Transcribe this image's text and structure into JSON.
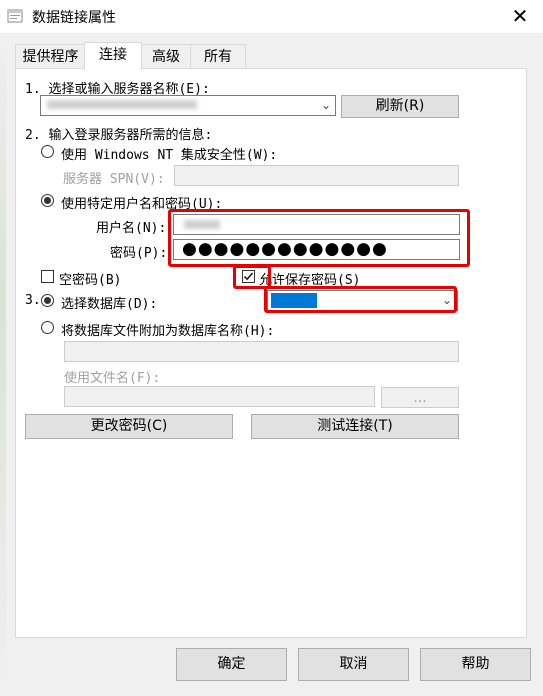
{
  "window": {
    "title": "数据链接属性",
    "icon": "data-link-icon",
    "close": "✕"
  },
  "tabs": [
    {
      "label": "提供程序"
    },
    {
      "label": "连接"
    },
    {
      "label": "高级"
    },
    {
      "label": "所有"
    }
  ],
  "step1": {
    "label": "1. 选择或输入服务器名称(E):",
    "server_value": "",
    "refresh_button": "刷新(R)"
  },
  "step2": {
    "label": "2. 输入登录服务器所需的信息:",
    "windows_nt": "使用 Windows NT 集成安全性(W):",
    "spn_label": "服务器 SPN(V):",
    "specific": "使用特定用户名和密码(U):",
    "username_label": "用户名(N):",
    "username_value": "",
    "password_label": "密码(P):",
    "password_value": "●●●●●●●●●●●●●",
    "blank_password": "空密码(B)",
    "allow_save": "允许保存密码(S)"
  },
  "step3": {
    "label": "3.",
    "select_db": "选择数据库(D):",
    "select_db_value": "",
    "attach_db": "将数据库文件附加为数据库名称(H):",
    "file_name_label": "使用文件名(F):",
    "browse_button": "..."
  },
  "buttons": {
    "change_password": "更改密码(C)",
    "test_connection": "测试连接(T)",
    "ok": "确定",
    "cancel": "取消",
    "help": "帮助"
  },
  "state": {
    "windows_nt_selected": false,
    "specific_selected": true,
    "blank_password_checked": false,
    "allow_save_checked": true,
    "select_db_selected": true,
    "attach_db_selected": false
  },
  "colors": {
    "highlight_red": "#e60000",
    "selection_blue": "#0078d7"
  }
}
